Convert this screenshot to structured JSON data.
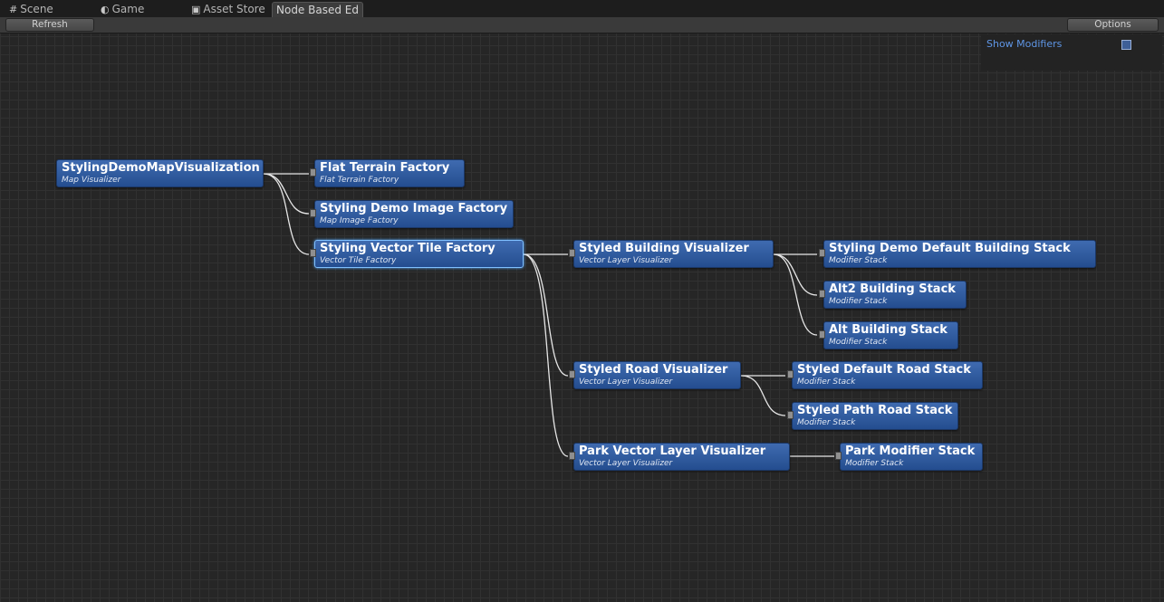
{
  "tabs": [
    {
      "label": "Scene",
      "icon": "grid-icon"
    },
    {
      "label": "Game",
      "icon": "pacman-icon"
    },
    {
      "label": "Asset Store",
      "icon": "lock-icon"
    },
    {
      "label": "Node Based Ed",
      "icon": ""
    }
  ],
  "toolbar": {
    "refresh_label": "Refresh",
    "options_label": "Options"
  },
  "panel": {
    "show_modifiers_label": "Show Modifiers",
    "show_modifiers_checked": false
  },
  "nodes": [
    {
      "title": "StylingDemoMapVisualization",
      "subtitle": "Map Visualizer"
    },
    {
      "title": "Flat Terrain Factory",
      "subtitle": "Flat Terrain Factory"
    },
    {
      "title": "Styling Demo Image Factory",
      "subtitle": "Map Image Factory"
    },
    {
      "title": "Styling Vector Tile Factory",
      "subtitle": "Vector Tile Factory"
    },
    {
      "title": "Styled Building Visualizer",
      "subtitle": "Vector Layer Visualizer"
    },
    {
      "title": "Styling Demo Default Building Stack",
      "subtitle": "Modifier Stack"
    },
    {
      "title": "Alt2 Building Stack",
      "subtitle": "Modifier Stack"
    },
    {
      "title": "Alt Building Stack",
      "subtitle": "Modifier Stack"
    },
    {
      "title": "Styled Road Visualizer",
      "subtitle": "Vector Layer Visualizer"
    },
    {
      "title": "Styled Default Road Stack",
      "subtitle": "Modifier Stack"
    },
    {
      "title": "Styled Path Road Stack",
      "subtitle": "Modifier Stack"
    },
    {
      "title": "Park Vector Layer Visualizer",
      "subtitle": "Vector Layer Visualizer"
    },
    {
      "title": "Park Modifier Stack",
      "subtitle": "Modifier Stack"
    }
  ],
  "selected_node": "Styling Vector Tile Factory"
}
